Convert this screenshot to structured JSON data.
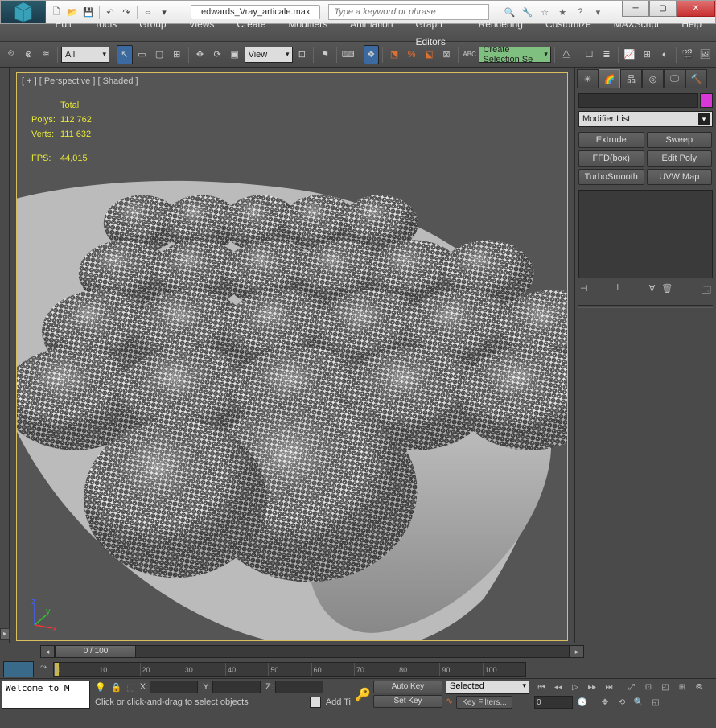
{
  "title": {
    "filename": "edwards_Vray_articale.max",
    "search_placeholder": "Type a keyword or phrase"
  },
  "menu": [
    "Edit",
    "Tools",
    "Group",
    "Views",
    "Create",
    "Modifiers",
    "Animation",
    "Graph Editors",
    "Rendering",
    "Customize",
    "MAXScript",
    "Help"
  ],
  "toolbar": {
    "selection_filter": "All",
    "ref_coord": "View",
    "named_sel": "Create Selection Se"
  },
  "viewport": {
    "label": "[ + ] [ Perspective ] [ Shaded ]",
    "stats": {
      "total_label": "Total",
      "polys_label": "Polys:",
      "polys_value": "112 762",
      "verts_label": "Verts:",
      "verts_value": "111 632",
      "fps_label": "FPS:",
      "fps_value": "44,015"
    }
  },
  "cmd_panel": {
    "modifier_list_label": "Modifier List",
    "quick_modifiers": [
      "Extrude",
      "Sweep",
      "FFD(box)",
      "Edit Poly",
      "TurboSmooth",
      "UVW Map"
    ]
  },
  "timeline": {
    "slider_label": "0 / 100",
    "ticks": [
      "0",
      "10",
      "20",
      "30",
      "40",
      "50",
      "60",
      "70",
      "80",
      "90",
      "100"
    ]
  },
  "status": {
    "maxscript": "Welcome to M",
    "x_label": "X:",
    "y_label": "Y:",
    "z_label": "Z:",
    "x_val": "",
    "y_val": "",
    "z_val": "",
    "prompt": "Click or click-and-drag to select objects",
    "add_time": "Add Ti",
    "auto_key": "Auto Key",
    "set_key": "Set Key",
    "key_mode": "Selected",
    "key_filters": "Key Filters...",
    "current_frame": "0"
  }
}
